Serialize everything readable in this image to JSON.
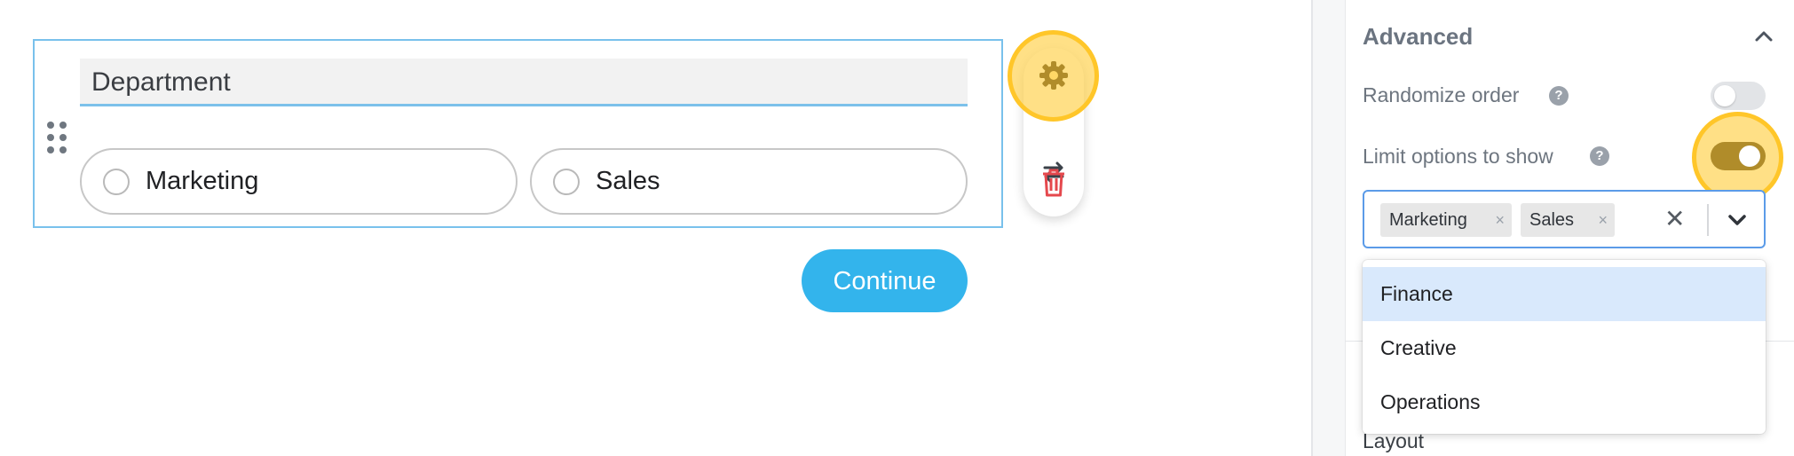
{
  "question": {
    "title": "Department",
    "options": [
      {
        "label": "Marketing"
      },
      {
        "label": "Sales"
      }
    ],
    "continue_label": "Continue"
  },
  "actions": {
    "icons": [
      "gear-icon",
      "swap-icon",
      "trash-icon"
    ]
  },
  "panel": {
    "section_title": "Advanced",
    "randomize_label": "Randomize order",
    "randomize_on": false,
    "limit_label": "Limit options to show",
    "limit_on": true,
    "help_glyph": "?",
    "selected_chips": [
      "Marketing",
      "Sales"
    ],
    "chip_remove_glyph": "×",
    "clear_glyph": "✕",
    "dropdown_options": [
      "Finance",
      "Creative",
      "Operations"
    ],
    "layout_label": "Layout"
  },
  "colors": {
    "accent": "#33b4ec",
    "selection_border": "#79c1ec",
    "highlight": "#ffc629",
    "toggle_on": "#b08c2a",
    "delete": "#e5484d"
  }
}
